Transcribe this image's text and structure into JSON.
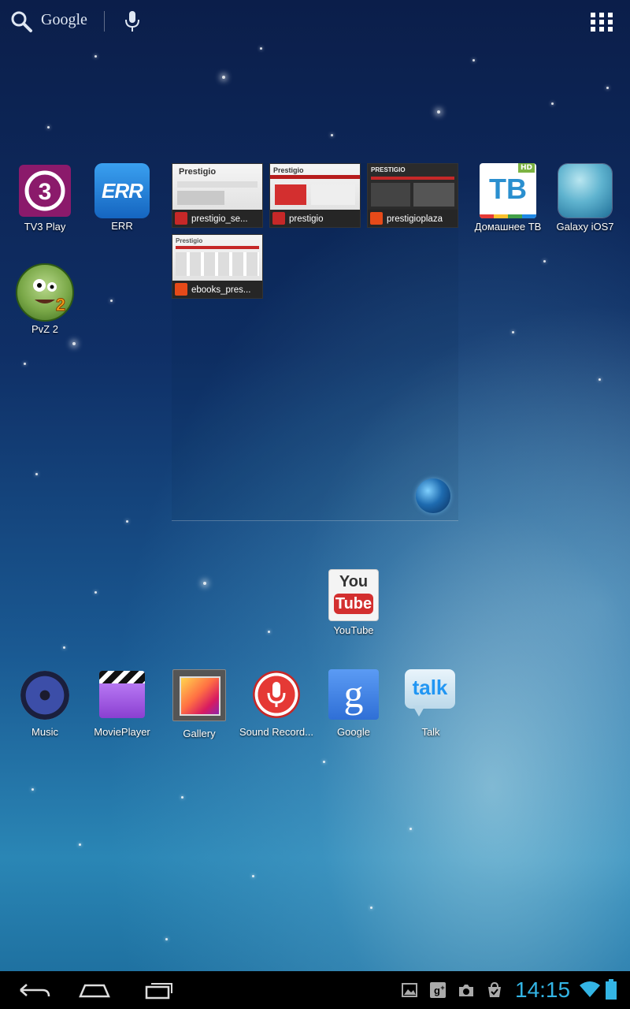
{
  "search": {
    "label": "Google"
  },
  "row1": [
    {
      "label": "TV3 Play"
    },
    {
      "label": "ERR",
      "icon_text": "ERR"
    }
  ],
  "row1_right": [
    {
      "label": "Домашнее ТВ",
      "icon_text": "ТВ",
      "badge": "HD"
    },
    {
      "label": "Galaxy iOS7"
    }
  ],
  "pvz": {
    "label": "PvZ 2"
  },
  "bookmarks": [
    {
      "name": "prestigio_se...",
      "thumb_title": "Prestigio"
    },
    {
      "name": "prestigio",
      "thumb_title": "Prestigio"
    },
    {
      "name": "prestigioplaza",
      "thumb_title": "PRESTIGIO"
    },
    {
      "name": "ebooks_pres...",
      "thumb_title": "Prestigio"
    }
  ],
  "youtube": {
    "label": "YouTube",
    "logo_top": "You",
    "logo_bottom": "Tube"
  },
  "dock": [
    {
      "label": "Music"
    },
    {
      "label": "MoviePlayer"
    },
    {
      "label": "Gallery"
    },
    {
      "label": "Sound Record..."
    },
    {
      "label": "Google",
      "icon_text": "g"
    },
    {
      "label": "Talk",
      "icon_text": "talk"
    }
  ],
  "status": {
    "time": "14:15"
  },
  "colors": {
    "accent": "#33b5e5",
    "tv3": "#8b1a6b",
    "err": "#1e88e5"
  }
}
